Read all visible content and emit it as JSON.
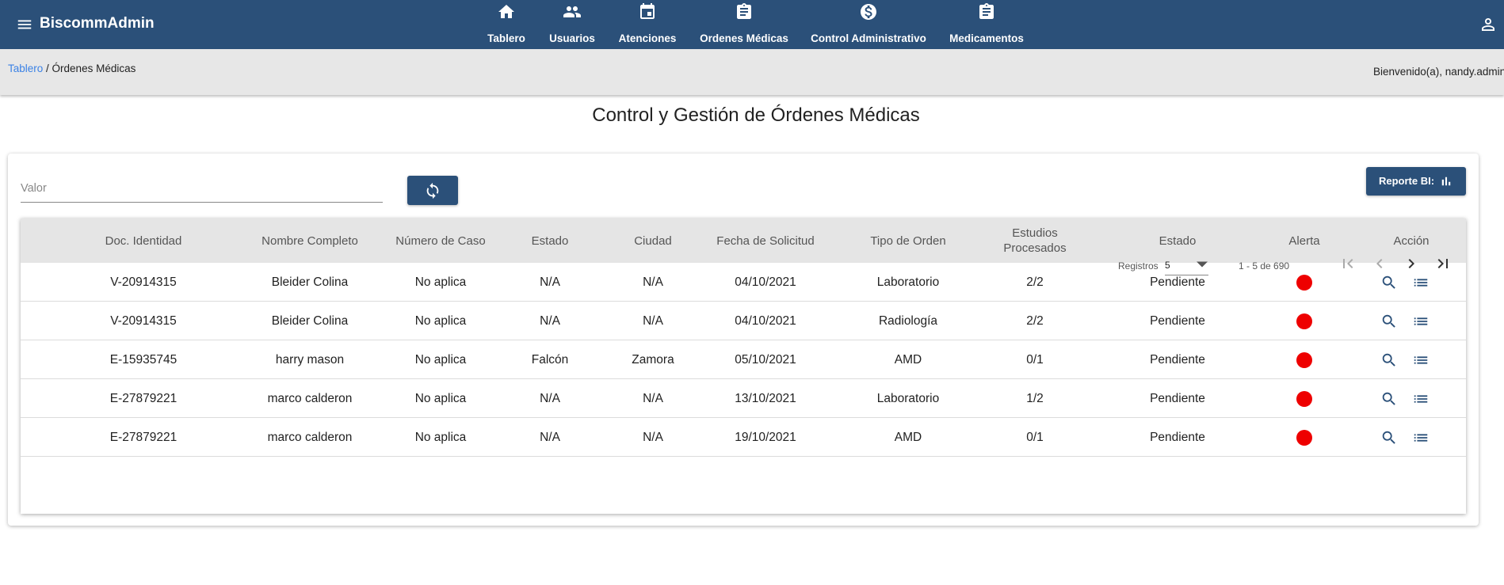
{
  "app": {
    "brand": "BiscommAdmin"
  },
  "nav": [
    {
      "label": "Tablero",
      "icon": "home-icon"
    },
    {
      "label": "Usuarios",
      "icon": "users-icon"
    },
    {
      "label": "Atenciones",
      "icon": "calendar-icon"
    },
    {
      "label": "Ordenes Médicas",
      "icon": "clipboard-icon"
    },
    {
      "label": "Control Administrativo",
      "icon": "dollar-icon"
    },
    {
      "label": "Medicamentos",
      "icon": "clipboard-icon"
    }
  ],
  "breadcrumb": {
    "home": "Tablero",
    "separator": " / ",
    "current": "Órdenes Médicas"
  },
  "welcome": "Bienvenido(a), nandy.admin",
  "page_title": "Control y Gestión de Órdenes Médicas",
  "search": {
    "placeholder": "Valor",
    "value": ""
  },
  "report_button": "Reporte BI:",
  "table": {
    "headers": [
      "Doc. Identidad",
      "Nombre Completo",
      "Número de Caso",
      "Estado",
      "Ciudad",
      "Fecha de Solicitud",
      "Tipo de Orden",
      "Estudios\nProcesados",
      "Estado",
      "Alerta",
      "Acción"
    ],
    "rows": [
      [
        "V-20914315",
        "Bleider Colina",
        "No aplica",
        "N/A",
        "N/A",
        "04/10/2021",
        "Laboratorio",
        "2/2",
        "Pendiente"
      ],
      [
        "V-20914315",
        "Bleider Colina",
        "No aplica",
        "N/A",
        "N/A",
        "04/10/2021",
        "Radiología",
        "2/2",
        "Pendiente"
      ],
      [
        "E-15935745",
        "harry mason",
        "No aplica",
        "Falcón",
        "Zamora",
        "05/10/2021",
        "AMD",
        "0/1",
        "Pendiente"
      ],
      [
        "E-27879221",
        "marco calderon",
        "No aplica",
        "N/A",
        "N/A",
        "13/10/2021",
        "Laboratorio",
        "1/2",
        "Pendiente"
      ],
      [
        "E-27879221",
        "marco calderon",
        "No aplica",
        "N/A",
        "N/A",
        "19/10/2021",
        "AMD",
        "0/1",
        "Pendiente"
      ]
    ],
    "alert_color": "#ee0000"
  },
  "paginator": {
    "label": "Registros",
    "page_size": "5",
    "range": "1 - 5 de 690"
  },
  "colors": {
    "primary": "#2b5079",
    "link": "#3b82e6",
    "header_bg": "#e5e5e5"
  }
}
